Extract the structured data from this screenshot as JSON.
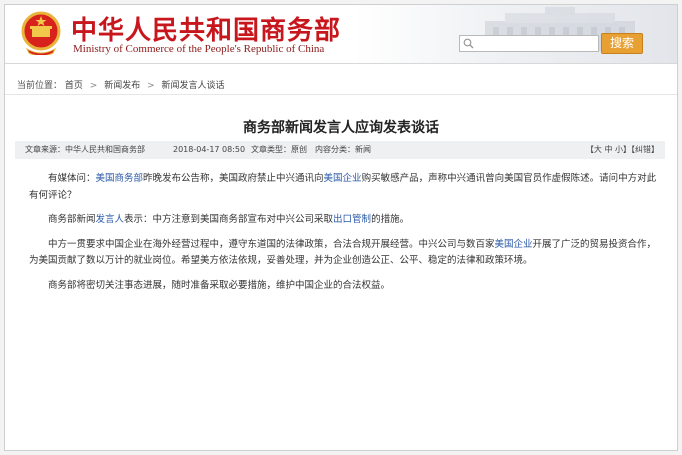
{
  "header": {
    "title_cn": "中华人民共和国商务部",
    "title_en": "Ministry of Commerce of the People's Republic of China",
    "emblem_icon": "national-emblem-icon",
    "search": {
      "placeholder": "",
      "button_label": "搜索"
    },
    "colors": {
      "brand_red": "#c8161d",
      "search_button": "#e8a032"
    }
  },
  "breadcrumb": {
    "prefix": "当前位置：",
    "items": [
      "首页",
      "新闻发布",
      "新闻发言人谈话"
    ],
    "separator": ">"
  },
  "article": {
    "title": "商务部新闻发言人应询发表谈话",
    "meta": {
      "source": "文章来源：中华人民共和国商务部",
      "date": "2018-04-17 08:50",
      "type": "文章类型：原创",
      "category": "内容分类：新闻",
      "controls": "【大 中 小】【纠错】"
    },
    "paragraphs": [
      {
        "p1": "有媒体问：",
        "l1": "美国商务部",
        "p2": "昨晚发布公告称，美国政府禁止中兴通讯向",
        "l2": "美国企业",
        "p3": "购买敏感产品，声称中兴通讯曾向美国官员作虚假陈述。请问中方对此有何评论？"
      },
      {
        "p1": "商务部新闻",
        "l1": "发言人",
        "p2": "表示：中方注意到美国商务部宣布对中兴公司采取",
        "l2": "出口管制",
        "p3": "的措施。"
      },
      {
        "p1": "中方一贯要求中国企业在海外经营过程中，遵守东道国的法律政策，合法合规开展经营。中兴公司与数百家",
        "l1": "美国企业",
        "p2": "开展了广泛的贸易投资合作，为美国贡献了数以万计的就业岗位。希望美方依法依规，妥善处理，并为企业创造公正、公平、稳定的法律和政策环境。"
      },
      {
        "p1": "商务部将密切关注事态进展，随时准备采取必要措施，维护中国企业的合法权益。"
      }
    ]
  }
}
